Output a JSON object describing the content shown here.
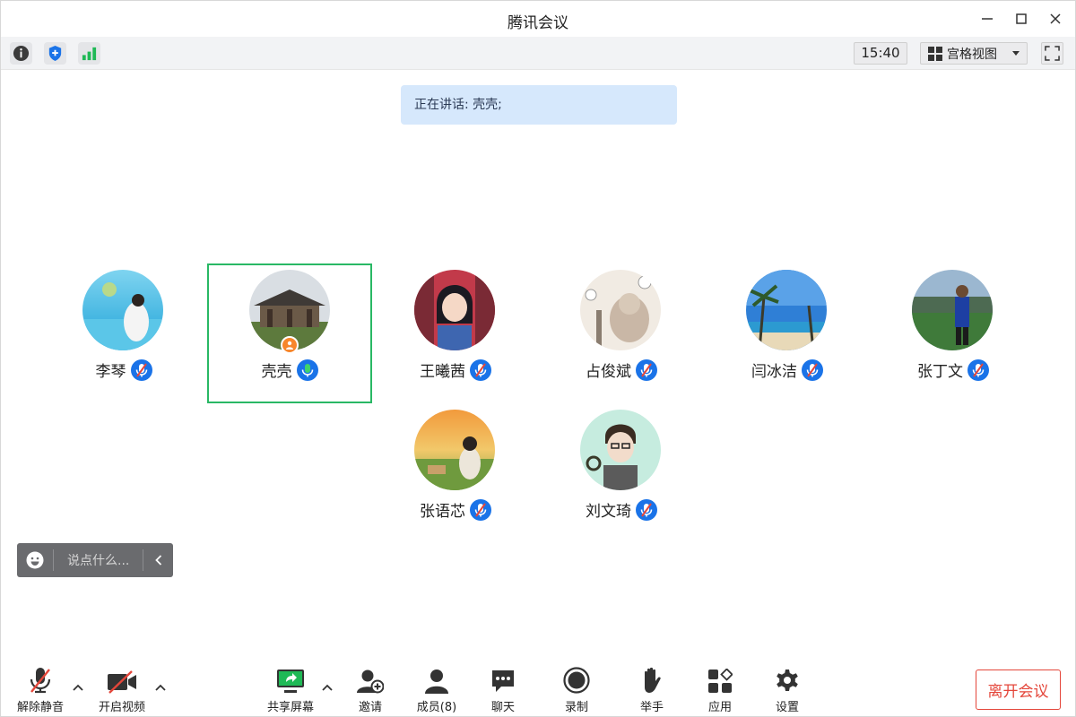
{
  "window": {
    "title": "腾讯会议"
  },
  "toolbar": {
    "time": "15:40",
    "view_label": "宫格视图"
  },
  "speaking": {
    "text": "正在讲话: 壳壳;"
  },
  "participants": [
    {
      "name": "李琴",
      "muted": true
    },
    {
      "name": "壳壳",
      "muted": false,
      "host": true,
      "active": true
    },
    {
      "name": "王曦茜",
      "muted": true
    },
    {
      "name": "占俊斌",
      "muted": true
    },
    {
      "name": "闫冰洁",
      "muted": true
    },
    {
      "name": "张丁文",
      "muted": true
    },
    {
      "name": "张语芯",
      "muted": true
    },
    {
      "name": "刘文琦",
      "muted": true
    }
  ],
  "chat": {
    "placeholder": "说点什么..."
  },
  "bottom": {
    "unmute": "解除静音",
    "video": "开启视频",
    "share": "共享屏幕",
    "invite": "邀请",
    "members": "成员(8)",
    "chat": "聊天",
    "record": "录制",
    "raise_hand": "举手",
    "apps": "应用",
    "settings": "设置",
    "leave": "离开会议"
  },
  "colors": {
    "accent_blue": "#1a73e8",
    "active_green": "#29b865",
    "leave_red": "#e4463a",
    "banner_bg": "#d6e8fc"
  }
}
